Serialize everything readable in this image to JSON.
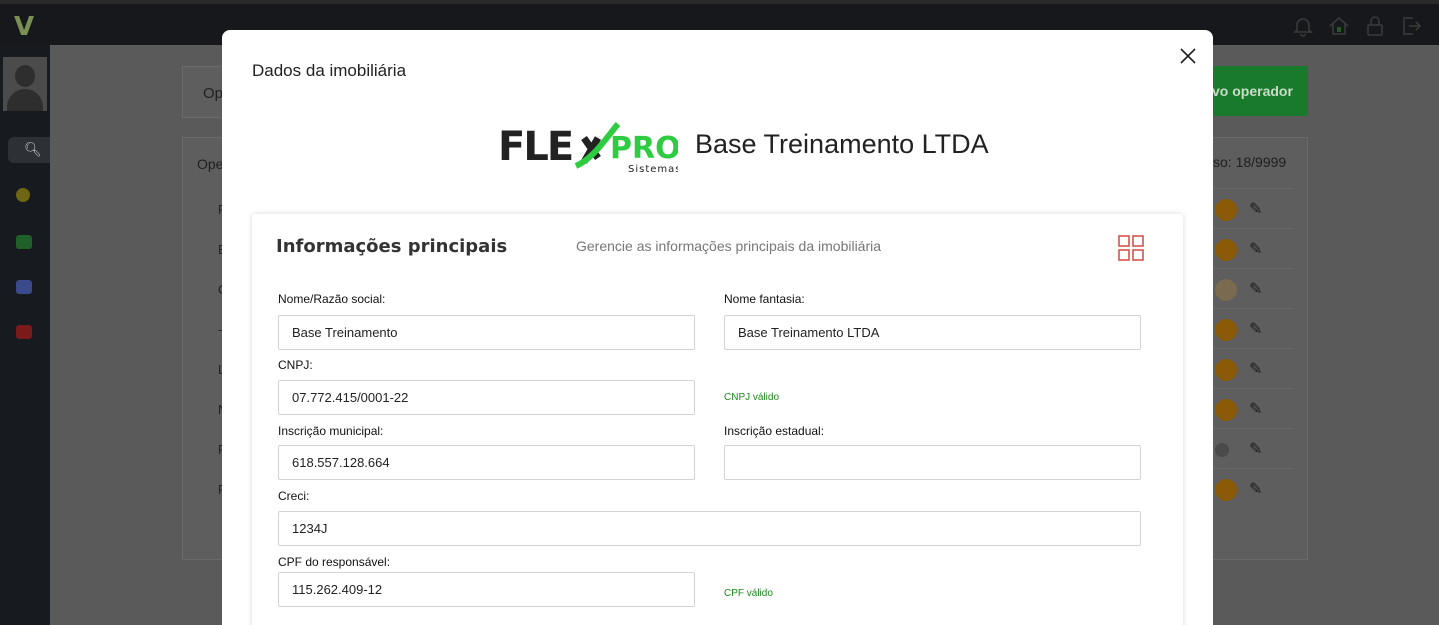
{
  "colors": {
    "accent_green": "#1b8a1b",
    "brand_green": "#2ecc40",
    "grid_icon": "#d9534f",
    "topbar": "#16181b"
  },
  "background": {
    "top_card_label": "Op",
    "new_operator_button": "vo operador",
    "table_header_left": "Ope",
    "usage_label": "so: 18/9999",
    "row_initials": [
      "F",
      "E",
      "C",
      "-",
      "L",
      "N",
      "F",
      "F"
    ],
    "row_toggles": [
      "on",
      "on",
      "light",
      "on",
      "on",
      "on",
      "off",
      "on"
    ]
  },
  "topbar": {
    "icons": [
      "bell-icon",
      "home-icon",
      "lock-icon",
      "logout-icon"
    ]
  },
  "sidebar": {
    "icons": [
      "search-icon",
      "dashboard-icon",
      "buildings-icon",
      "users-icon",
      "settings-icon"
    ]
  },
  "modal": {
    "title": "Dados da imobiliária",
    "brand_primary": "FLEXPRO",
    "brand_secondary": "Sistemas",
    "company_name": "Base Treinamento LTDA",
    "section": {
      "title": "Informações principais",
      "subtitle": "Gerencie as informações principais da imobiliária"
    },
    "fields": {
      "razao_social": {
        "label": "Nome/Razão social:",
        "value": "Base Treinamento"
      },
      "nome_fantasia": {
        "label": "Nome fantasia:",
        "value": "Base Treinamento LTDA"
      },
      "cnpj": {
        "label": "CNPJ:",
        "value": "07.772.415/0001-22",
        "status": "CNPJ válido"
      },
      "inscricao_municipal": {
        "label": "Inscrição municipal:",
        "value": "618.557.128.664"
      },
      "inscricao_estadual": {
        "label": "Inscrição estadual:",
        "value": ""
      },
      "creci": {
        "label": "Creci:",
        "value": "1234J"
      },
      "cpf_responsavel": {
        "label": "CPF do responsável:",
        "value": "115.262.409-12",
        "status": "CPF válido"
      }
    }
  }
}
